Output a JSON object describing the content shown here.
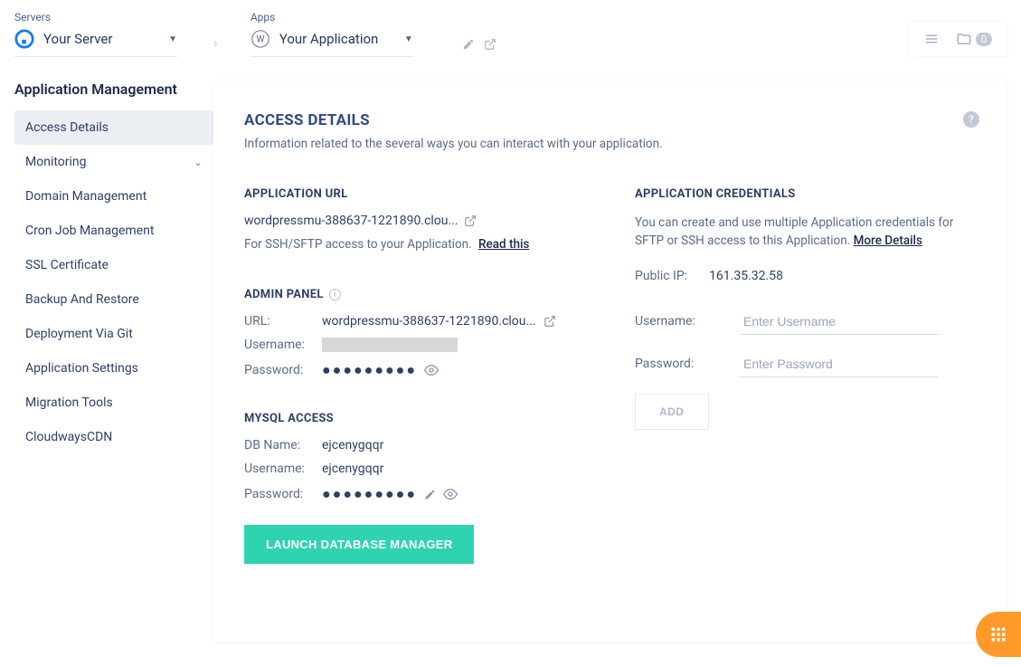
{
  "breadcrumb": {
    "servers_label": "Servers",
    "server_name": "Your Server",
    "apps_label": "Apps",
    "app_name": "Your Application"
  },
  "top_toolbar": {
    "badge_count": "0"
  },
  "sidebar": {
    "heading": "Application Management",
    "items": [
      {
        "label": "Access Details",
        "active": true,
        "expandable": false
      },
      {
        "label": "Monitoring",
        "active": false,
        "expandable": true
      },
      {
        "label": "Domain Management",
        "active": false,
        "expandable": false
      },
      {
        "label": "Cron Job Management",
        "active": false,
        "expandable": false
      },
      {
        "label": "SSL Certificate",
        "active": false,
        "expandable": false
      },
      {
        "label": "Backup And Restore",
        "active": false,
        "expandable": false
      },
      {
        "label": "Deployment Via Git",
        "active": false,
        "expandable": false
      },
      {
        "label": "Application Settings",
        "active": false,
        "expandable": false
      },
      {
        "label": "Migration Tools",
        "active": false,
        "expandable": false
      },
      {
        "label": "CloudwaysCDN",
        "active": false,
        "expandable": false
      }
    ]
  },
  "main": {
    "title": "ACCESS DETAILS",
    "subtitle": "Information related to the several ways you can interact with your application.",
    "app_url": {
      "heading": "APPLICATION URL",
      "url": "wordpressmu-388637-1221890.clou...",
      "ssh_text": "For SSH/SFTP access to your Application.",
      "read_this": "Read this"
    },
    "admin_panel": {
      "heading": "ADMIN PANEL",
      "url_label": "URL:",
      "url": "wordpressmu-388637-1221890.clou...",
      "username_label": "Username:",
      "password_label": "Password:",
      "password_masked": "●●●●●●●●●"
    },
    "mysql": {
      "heading": "MYSQL ACCESS",
      "dbname_label": "DB Name:",
      "dbname": "ejcenygqqr",
      "username_label": "Username:",
      "username": "ejcenygqqr",
      "password_label": "Password:",
      "password_masked": "●●●●●●●●●",
      "launch_btn": "LAUNCH DATABASE MANAGER"
    },
    "credentials": {
      "heading": "APPLICATION CREDENTIALS",
      "desc1": "You can create and use multiple Application credentials for SFTP or SSH access to this Application. ",
      "more_details": "More Details",
      "public_ip_label": "Public IP:",
      "public_ip": "161.35.32.58",
      "username_label": "Username:",
      "username_placeholder": "Enter Username",
      "password_label": "Password:",
      "password_placeholder": "Enter Password",
      "add_btn": "ADD"
    }
  }
}
